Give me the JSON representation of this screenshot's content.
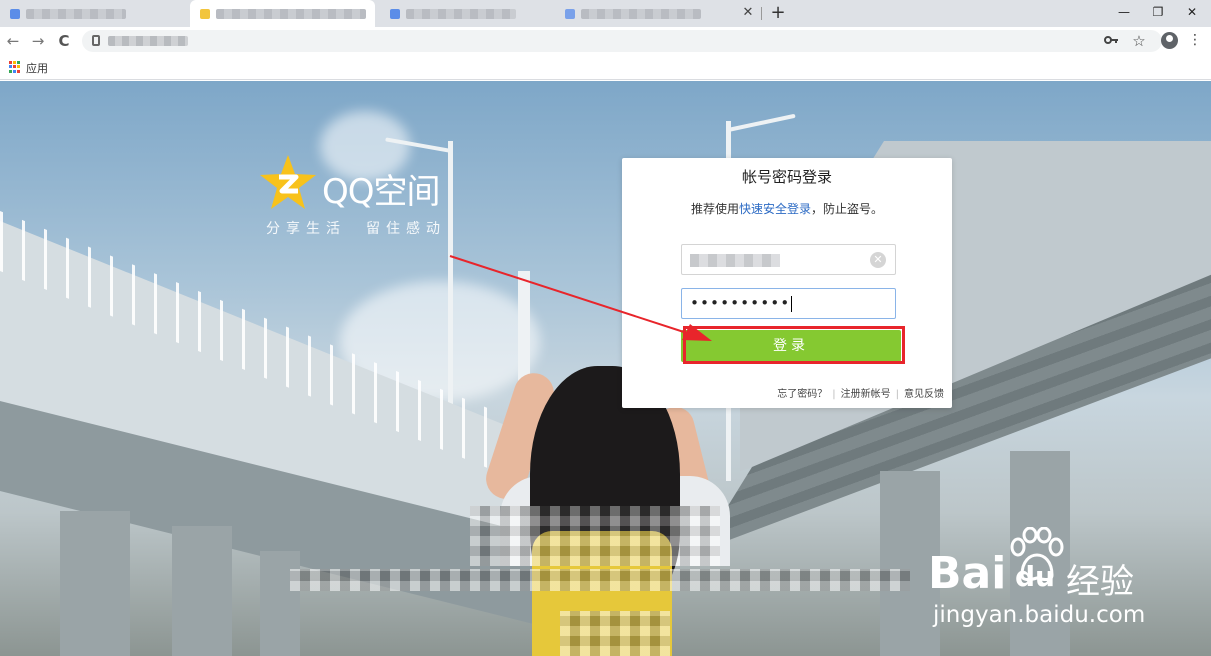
{
  "browser": {
    "new_tab_symbol": "+",
    "close_tab_symbol": "✕",
    "window_controls": {
      "minimize": "—",
      "maximize": "❐",
      "close": "✕"
    },
    "nav": {
      "back": "←",
      "forward": "→",
      "reload": "C"
    },
    "omnibox_icons": {
      "key": "key-icon",
      "star": "☆"
    },
    "menu_symbol": "⋮",
    "bookmarks": {
      "apps_label": "应用"
    }
  },
  "page": {
    "logo": {
      "text": "QQ空间",
      "slogan": "分享生活　留住感动"
    },
    "login": {
      "title": "帐号密码登录",
      "tip_prefix": "推荐使用",
      "tip_link": "快速安全登录",
      "tip_suffix": "，防止盗号。",
      "password_value": "••••••••••",
      "button_label": "登录",
      "links": {
        "forgot": "忘了密码？",
        "register": "注册新帐号",
        "feedback": "意见反馈"
      },
      "separator": "|"
    },
    "watermark": {
      "bai": "Bai",
      "du": "du",
      "jingyan": "经验",
      "url": "jingyan.baidu.com"
    }
  },
  "colors": {
    "accent_green": "#85c931",
    "annotation_red": "#e8252b",
    "link_blue": "#2b6ac4",
    "star_yellow": "#f8c21b"
  }
}
